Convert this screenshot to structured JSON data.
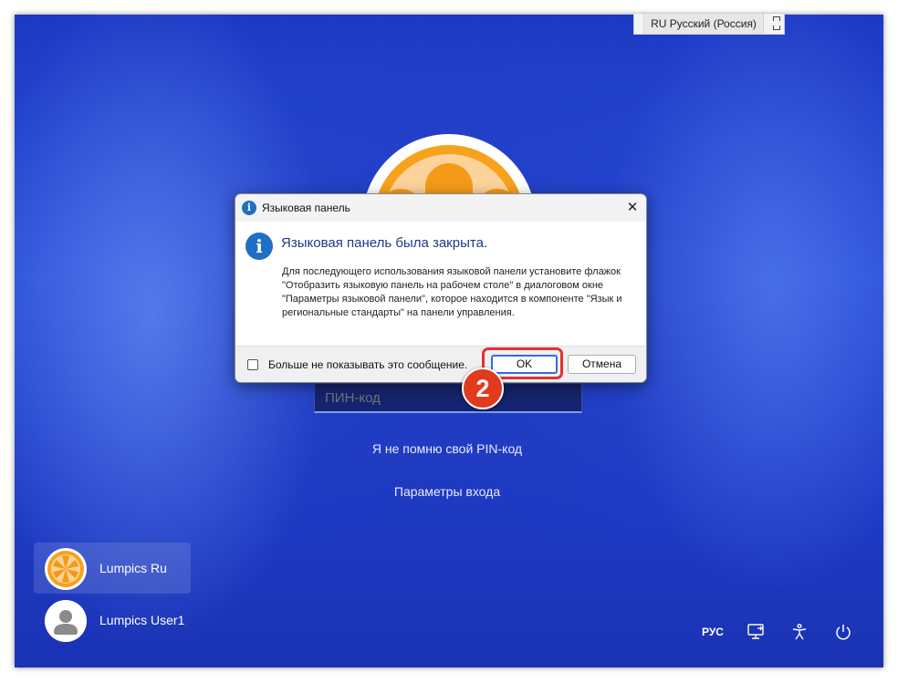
{
  "language_bar": {
    "label": "RU Русский (Россия)"
  },
  "pin_field": {
    "placeholder": "ПИН-код"
  },
  "links": {
    "forgot_pin": "Я не помню свой PIN-код",
    "sign_in_options": "Параметры входа"
  },
  "users": [
    {
      "name": "Lumpics Ru",
      "active": true
    },
    {
      "name": "Lumpics User1",
      "active": false
    }
  ],
  "tray": {
    "input_language": "РУС",
    "icons": [
      "network-icon",
      "accessibility-icon",
      "power-icon"
    ]
  },
  "dialog": {
    "title": "Языковая панель",
    "close": "✕",
    "info_glyph": "i",
    "headline": "Языковая панель была закрыта.",
    "message": "Для последующего использования языковой панели установите флажок \"Отобразить языковую панель на рабочем столе\" в диалоговом окне \"Параметры языковой панели\", которое находится в компоненте \"Язык и региональные стандарты\" на панели управления.",
    "checkbox_label": "Больше не показывать это сообщение.",
    "checkbox_checked": false,
    "ok_label": "OK",
    "cancel_label": "Отмена"
  },
  "annotation": {
    "step_number": "2"
  },
  "colors": {
    "accent": "#1f6fc6",
    "highlight": "#e53030",
    "badge": "#e23a1c",
    "avatar_orange": "#f7a21b"
  }
}
